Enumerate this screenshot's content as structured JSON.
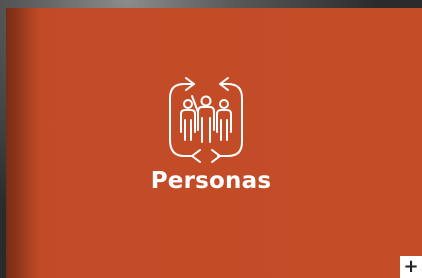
{
  "card": {
    "title": "Personas",
    "icon": "people-cycle-icon",
    "background_color": "#c44d28",
    "text_color": "#ffffff"
  },
  "expand_button": {
    "label": "+",
    "icon": "plus-icon"
  }
}
